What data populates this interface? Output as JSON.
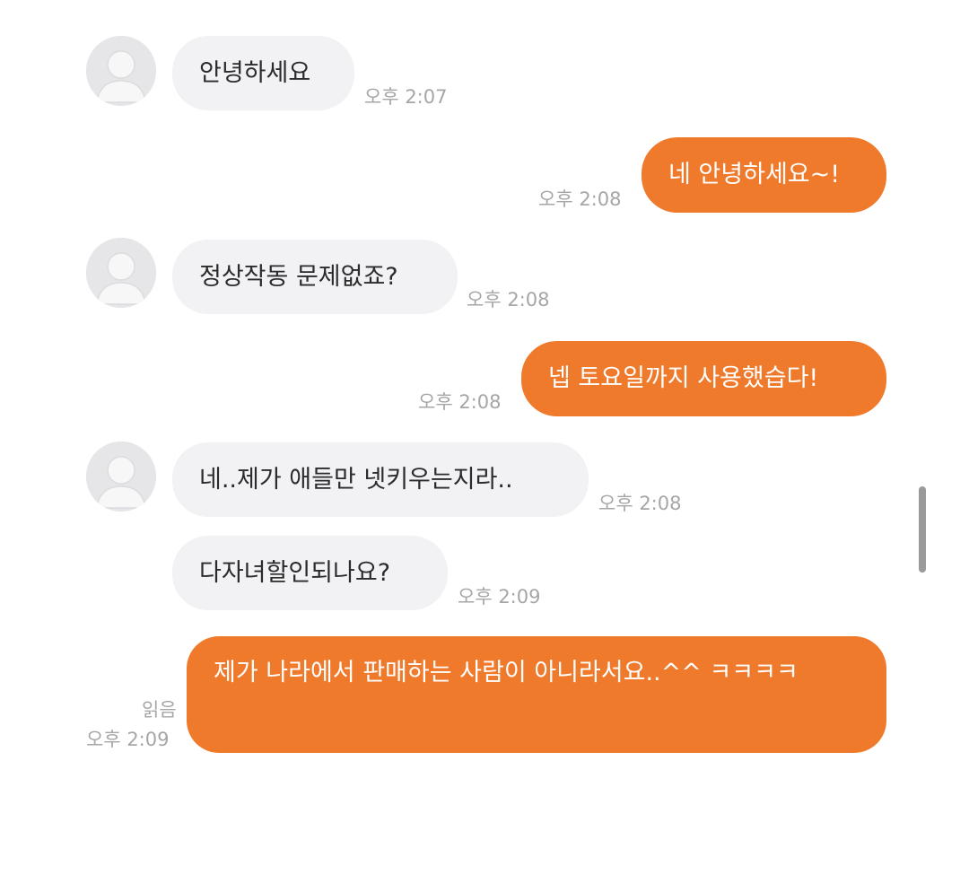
{
  "messages": [
    {
      "side": "in",
      "text": "안녕하세요",
      "time": "오후 2:07"
    },
    {
      "side": "out",
      "text": "네 안녕하세요~!",
      "time": "오후 2:08"
    },
    {
      "side": "in",
      "text": "정상작동 문제없죠?",
      "time": "오후 2:08"
    },
    {
      "side": "out",
      "text": "넵 토요일까지 사용했습다!",
      "time": "오후 2:08"
    },
    {
      "side": "in",
      "text": "네..제가 애들만 넷키우는지라..",
      "time": "오후 2:08"
    },
    {
      "side": "in",
      "text": "다자녀할인되나요?",
      "time": "오후 2:09"
    },
    {
      "side": "out",
      "text": "제가 나라에서 판매하는 사람이 아니라서요..^^ ㅋㅋㅋㅋ",
      "time": "오후 2:09",
      "read": "읽음"
    }
  ],
  "colors": {
    "outgoing_bubble": "#f07a2c",
    "incoming_bubble": "#f2f2f5",
    "timestamp": "#a6a6a6"
  },
  "icons": {
    "avatar": "default-profile-icon"
  }
}
